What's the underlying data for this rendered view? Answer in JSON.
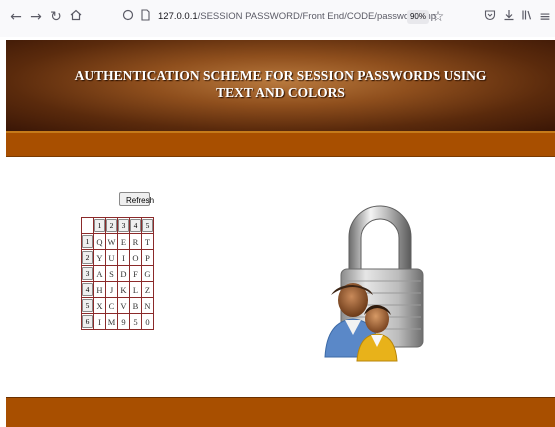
{
  "browser": {
    "url_prefix": "127.0.0.1",
    "url_path": "/SESSION PASSWORD/Front End/CODE/password.php",
    "zoom": "90%"
  },
  "header": {
    "title_line1": "AUTHENTICATION SCHEME FOR SESSION PASSWORDS USING",
    "title_line2": "TEXT AND COLORS"
  },
  "refresh_label": "Refresh",
  "grid": {
    "col_headers": [
      "1",
      "2",
      "3",
      "4",
      "5"
    ],
    "rows": [
      {
        "header": "1",
        "cells": [
          "Q",
          "W",
          "E",
          "R",
          "T"
        ]
      },
      {
        "header": "2",
        "cells": [
          "Y",
          "U",
          "I",
          "O",
          "P"
        ]
      },
      {
        "header": "3",
        "cells": [
          "A",
          "S",
          "D",
          "F",
          "G"
        ]
      },
      {
        "header": "4",
        "cells": [
          "H",
          "J",
          "K",
          "L",
          "Z"
        ]
      },
      {
        "header": "5",
        "cells": [
          "X",
          "C",
          "V",
          "B",
          "N"
        ]
      },
      {
        "header": "6",
        "cells": [
          "I",
          "M",
          "9",
          "5",
          "0"
        ]
      }
    ]
  },
  "colors": {
    "banner_dark": "#5a2a0c",
    "strip": "#a84f00",
    "grid_border": "#8b2a2a"
  }
}
